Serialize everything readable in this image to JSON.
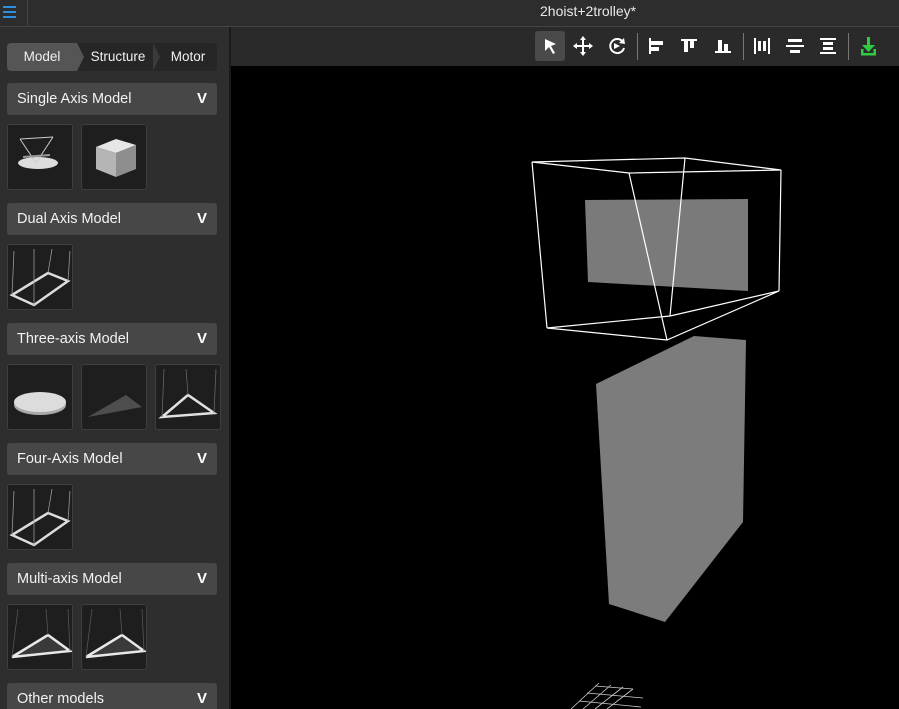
{
  "window": {
    "title": "2hoist+2trolley*"
  },
  "tabs": [
    {
      "label": "Model",
      "active": true
    },
    {
      "label": "Structure",
      "active": false
    },
    {
      "label": "Motor",
      "active": false
    }
  ],
  "sections": [
    {
      "label": "Single Axis Model",
      "chevron": "V",
      "thumbs": [
        "single-axis-swing-model",
        "cube-model"
      ]
    },
    {
      "label": "Dual Axis Model",
      "chevron": "V",
      "thumbs": [
        "dual-axis-frame-model"
      ]
    },
    {
      "label": "Three-axis Model",
      "chevron": "V",
      "thumbs": [
        "disc-model",
        "triangle-plane-model",
        "triangle-frame-model"
      ]
    },
    {
      "label": "Four-Axis Model",
      "chevron": "V",
      "thumbs": [
        "four-axis-frame-model"
      ]
    },
    {
      "label": "Multi-axis Model",
      "chevron": "V",
      "thumbs": [
        "multi-axis-triangle-model-1",
        "multi-axis-triangle-model-2"
      ]
    },
    {
      "label": "Other models",
      "chevron": "V",
      "thumbs": []
    }
  ],
  "toolbar": {
    "tools": [
      "select-arrow-icon",
      "move-icon",
      "rotate-icon",
      "align-left-icon",
      "align-top-icon",
      "align-bottom-icon",
      "distribute-horizontal-icon",
      "distribute-center-icon",
      "distribute-vertical-icon",
      "download-icon"
    ],
    "active_tool": "select-arrow-icon",
    "download_color": "#2ecc40"
  },
  "viewport": {
    "background": "#000000",
    "objects": [
      "wireframe-box-with-panel",
      "grey-panel",
      "floor-grid"
    ]
  }
}
